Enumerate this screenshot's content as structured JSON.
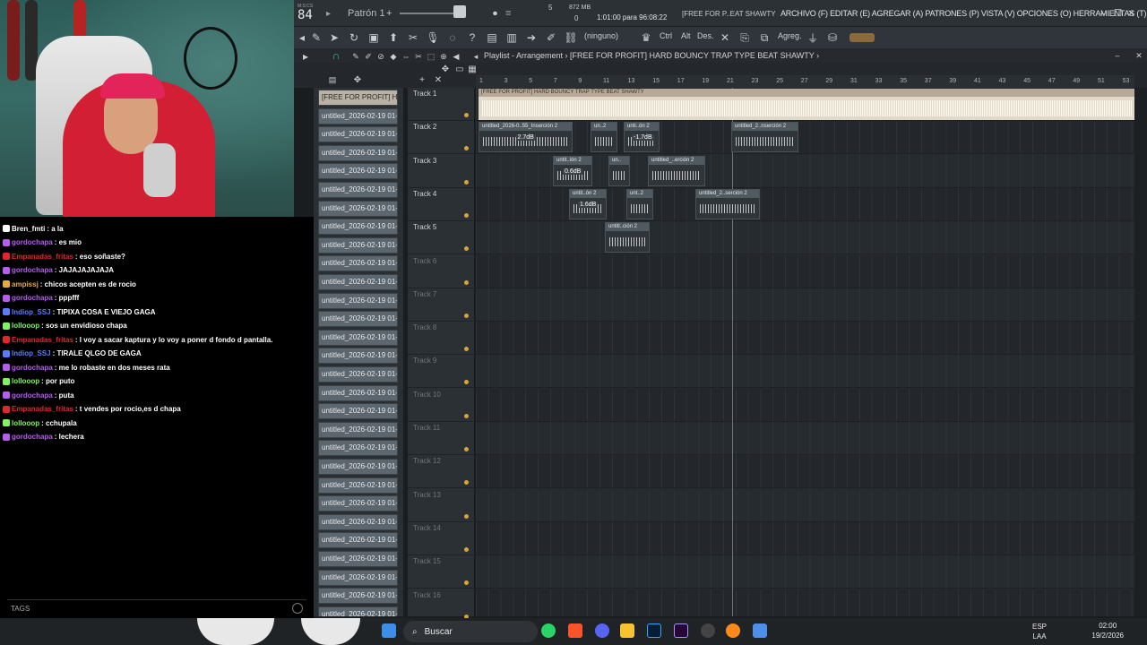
{
  "topbar": {
    "tempo_label": "M:S:CS",
    "tempo": "84",
    "pattern": "Patrón 1",
    "time_sig": "5",
    "memory": "872 MB",
    "cpu_zero": "0",
    "time_display": "1:01:00 para 96:08:22",
    "hint": "[FREE FOR P..EAT SHAWTY",
    "menu": "ARCHIVO (F) EDITAR (E) AGREGAR (A) PATRONES (P) VISTA (V) OPCIONES (O) HERRAMIENTAS (T) AYUDA"
  },
  "toolbar": {
    "none_label": "(ninguno)",
    "ctrl": "Ctrl",
    "alt": "Alt",
    "des": "Des.",
    "agreg": "Agreg."
  },
  "playlist": {
    "title": "Playlist - Arrangement",
    "song": "[FREE FOR PROFIT] HARD BOUNCY TRAP TYPE BEAT SHAWTY",
    "picker_first": "[FREE FOR PROFIT] H...",
    "picker_item": "untitled_2026-02-19 01-...",
    "ruler": [
      "1",
      "3",
      "5",
      "7",
      "9",
      "11",
      "13",
      "15",
      "17",
      "19",
      "21",
      "23",
      "25",
      "27",
      "29",
      "31",
      "33",
      "35",
      "37",
      "39",
      "41",
      "43",
      "45",
      "47",
      "49",
      "51",
      "53"
    ],
    "tracks": [
      "Track 1",
      "Track 2",
      "Track 3",
      "Track 4",
      "Track 5",
      "Track 6",
      "Track 7",
      "Track 8",
      "Track 9",
      "Track 10",
      "Track 11",
      "Track 12",
      "Track 13",
      "Track 14",
      "Track 15",
      "Track 16"
    ],
    "main_clip": "[FREE FOR PROFIT] HARD BOUNCY TRAP TYPE BEAT SHAWTY",
    "clips": [
      {
        "label": "untitled_2026-0..55_Inserción 2",
        "gain": "2.7dB"
      },
      {
        "label": "un..2",
        "gain": ""
      },
      {
        "label": "unti..ón 2",
        "gain": "-1.7dB"
      },
      {
        "label": "untitled_2..nserción 2",
        "gain": ""
      },
      {
        "label": "untit..ión 2",
        "gain": "0.6dB"
      },
      {
        "label": "un..",
        "gain": ""
      },
      {
        "label": "untitled_..erción 2",
        "gain": ""
      },
      {
        "label": "untit..ón 2",
        "gain": "1.6dB"
      },
      {
        "label": "unt..2",
        "gain": ""
      },
      {
        "label": "untitled_2..serción 2",
        "gain": ""
      },
      {
        "label": "untitl..ción 2",
        "gain": ""
      }
    ]
  },
  "chat": {
    "messages": [
      {
        "user": "Bren_fmti",
        "text": ": a la",
        "color": "#ffffff"
      },
      {
        "user": "gordochapa",
        "text": ": es mio",
        "color": "#b65cf0"
      },
      {
        "user": "Empanadas_fritas",
        "text": ": eso soñaste?",
        "color": "#e0262f"
      },
      {
        "user": "gordochapa",
        "text": ": JAJAJAJAJAJA",
        "color": "#b65cf0"
      },
      {
        "user": "ampissj",
        "text": ": chicos acepten es de rocio",
        "color": "#e6a93a"
      },
      {
        "user": "gordochapa",
        "text": ": pppfff",
        "color": "#b65cf0"
      },
      {
        "user": "Indiop_SSJ",
        "text": ": TIPIXA COSA E VIEJO GAGA",
        "color": "#5b7cff"
      },
      {
        "user": "lollooop",
        "text": ": sos un envidioso chapa",
        "color": "#7cf65a"
      },
      {
        "user": "Empanadas_fritas",
        "text": ": I voy a sacar kaptura y lo voy a poner d fondo d pantalla.",
        "color": "#e0262f"
      },
      {
        "user": "Indiop_SSJ",
        "text": ": TIRALE QLGO DE GAGA",
        "color": "#5b7cff"
      },
      {
        "user": "gordochapa",
        "text": ": me lo robaste en dos meses rata",
        "color": "#b65cf0"
      },
      {
        "user": "lollooop",
        "text": ": por puto",
        "color": "#7cf65a"
      },
      {
        "user": "gordochapa",
        "text": ": puta",
        "color": "#b65cf0"
      },
      {
        "user": "Empanadas_fritas",
        "text": ": t vendes por rocio,es d chapa",
        "color": "#e0262f"
      },
      {
        "user": "lollooop",
        "text": ": cchupala",
        "color": "#7cf65a"
      },
      {
        "user": "gordochapa",
        "text": ": lechera",
        "color": "#b65cf0"
      }
    ],
    "tags_label": "TAGS"
  },
  "taskbar": {
    "search": "Buscar",
    "lang1": "ESP",
    "lang2": "LAA",
    "time": "02:00",
    "date": "19/2/2026"
  }
}
